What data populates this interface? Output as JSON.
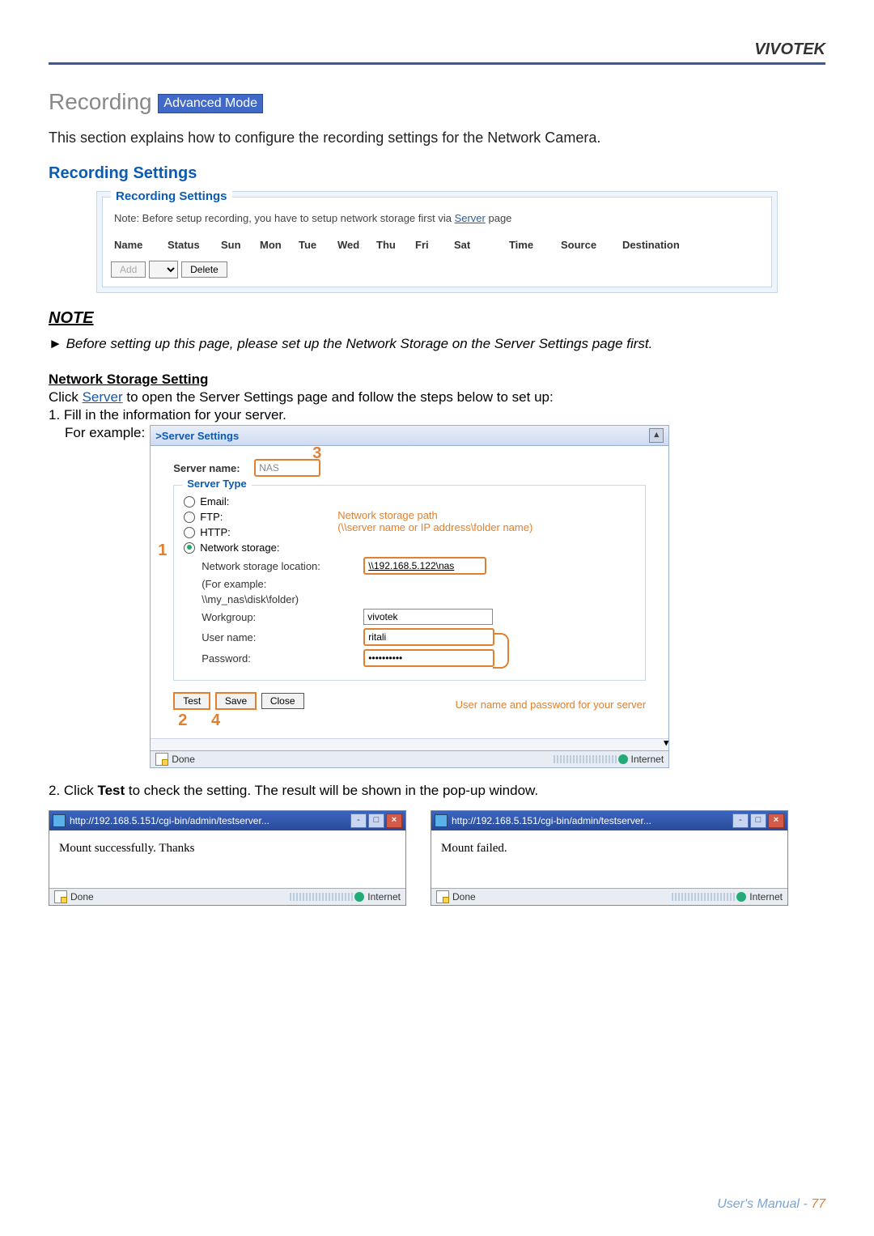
{
  "header": {
    "brand": "VIVOTEK"
  },
  "section": {
    "title": "Recording",
    "badge": "Advanced Mode"
  },
  "intro": "This section explains how to configure the recording settings for the Network Camera.",
  "subsection": {
    "title": "Recording Settings"
  },
  "recording_box": {
    "legend": "Recording Settings",
    "note_prefix": "Note: Before setup recording, you have to setup network storage first via ",
    "note_link": "Server",
    "note_suffix": " page",
    "columns": [
      "Name",
      "Status",
      "Sun",
      "Mon",
      "Tue",
      "Wed",
      "Thu",
      "Fri",
      "Sat",
      "Time",
      "Source",
      "Destination"
    ],
    "add": "Add",
    "delete": "Delete"
  },
  "note_block": {
    "heading": "NOTE",
    "arrow": "►",
    "text": "Before setting up this page, please set up the Network Storage on the Server Settings page first."
  },
  "nss": {
    "heading": "Network Storage Setting",
    "line1_pre": "Click ",
    "line1_link": "Server",
    "line1_post": " to open the Server Settings page and follow the steps below to set up:",
    "step1": "1. Fill in the information for your server.",
    "for_example": "For example:"
  },
  "server_settings": {
    "titlebar": ">Server Settings",
    "server_name_label": "Server name:",
    "server_name_value": "NAS",
    "fieldset": "Server Type",
    "options": {
      "email": "Email:",
      "ftp": "FTP:",
      "http": "HTTP:",
      "network": "Network storage:"
    },
    "ns_location_label": "Network storage location:",
    "ns_location_value": "\\\\192.168.5.122\\nas",
    "ns_example_label": "(For example:",
    "ns_example_value": "\\\\my_nas\\disk\\folder)",
    "workgroup_label": "Workgroup:",
    "workgroup_value": "vivotek",
    "username_label": "User name:",
    "username_value": "ritali",
    "password_label": "Password:",
    "password_value": "••••••••••",
    "buttons": {
      "test": "Test",
      "save": "Save",
      "close": "Close"
    },
    "status_done": "Done",
    "status_zone": "Internet",
    "annot_path_line1": "Network storage path",
    "annot_path_line2": "(\\\\server name or IP address\\folder name)",
    "annot_userpw": "User name and password for your server",
    "callouts": {
      "one": "1",
      "two": "2",
      "three": "3",
      "four": "4"
    }
  },
  "step2_pre": "2. Click ",
  "step2_bold": "Test",
  "step2_post": " to check the setting. The result will be shown in the pop-up window.",
  "popups": {
    "url": "http://192.168.5.151/cgi-bin/admin/testserver...",
    "success": "Mount successfully. Thanks",
    "fail": "Mount failed.",
    "status_done": "Done",
    "status_zone": "Internet"
  },
  "footer": {
    "label": "User's Manual - ",
    "page": "77"
  }
}
